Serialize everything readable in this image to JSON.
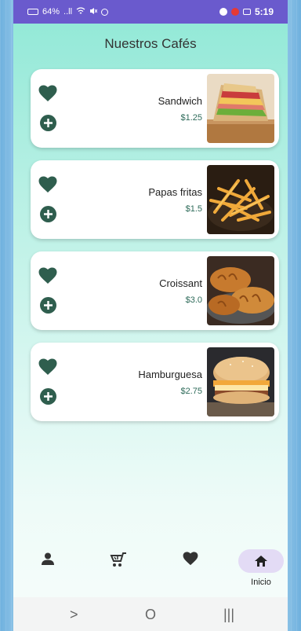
{
  "status_bar": {
    "time": "5:19",
    "left_text": "64%",
    "signal_text": "..ll",
    "icons": [
      "battery-icon",
      "wifi-icon",
      "signal-icon",
      "mute-icon",
      "alarm-icon",
      "gallery-icon",
      "youtube-icon",
      "app-icon"
    ]
  },
  "page": {
    "title": "Nuestros Cafés"
  },
  "products": [
    {
      "name": "Sandwich",
      "price": "$1.25",
      "image": "sandwich"
    },
    {
      "name": "Papas fritas",
      "price": "$1.5",
      "image": "fries"
    },
    {
      "name": "Croissant",
      "price": "$3.0",
      "image": "croissant"
    },
    {
      "name": "Hamburguesa",
      "price": "$2.75",
      "image": "burger"
    }
  ],
  "bottom_nav": {
    "items": [
      {
        "icon": "person-icon"
      },
      {
        "icon": "cart-icon"
      },
      {
        "icon": "heart-icon"
      },
      {
        "icon": "home-icon",
        "label": "Inicio",
        "active": true
      }
    ],
    "home_label": "Inicio"
  },
  "system_nav": {
    "back": ">",
    "home": "O",
    "recents": "|||"
  },
  "colors": {
    "accent": "#2f5e4e",
    "status_bar": "#6a5acd",
    "nav_pill": "#e3dbf5"
  }
}
